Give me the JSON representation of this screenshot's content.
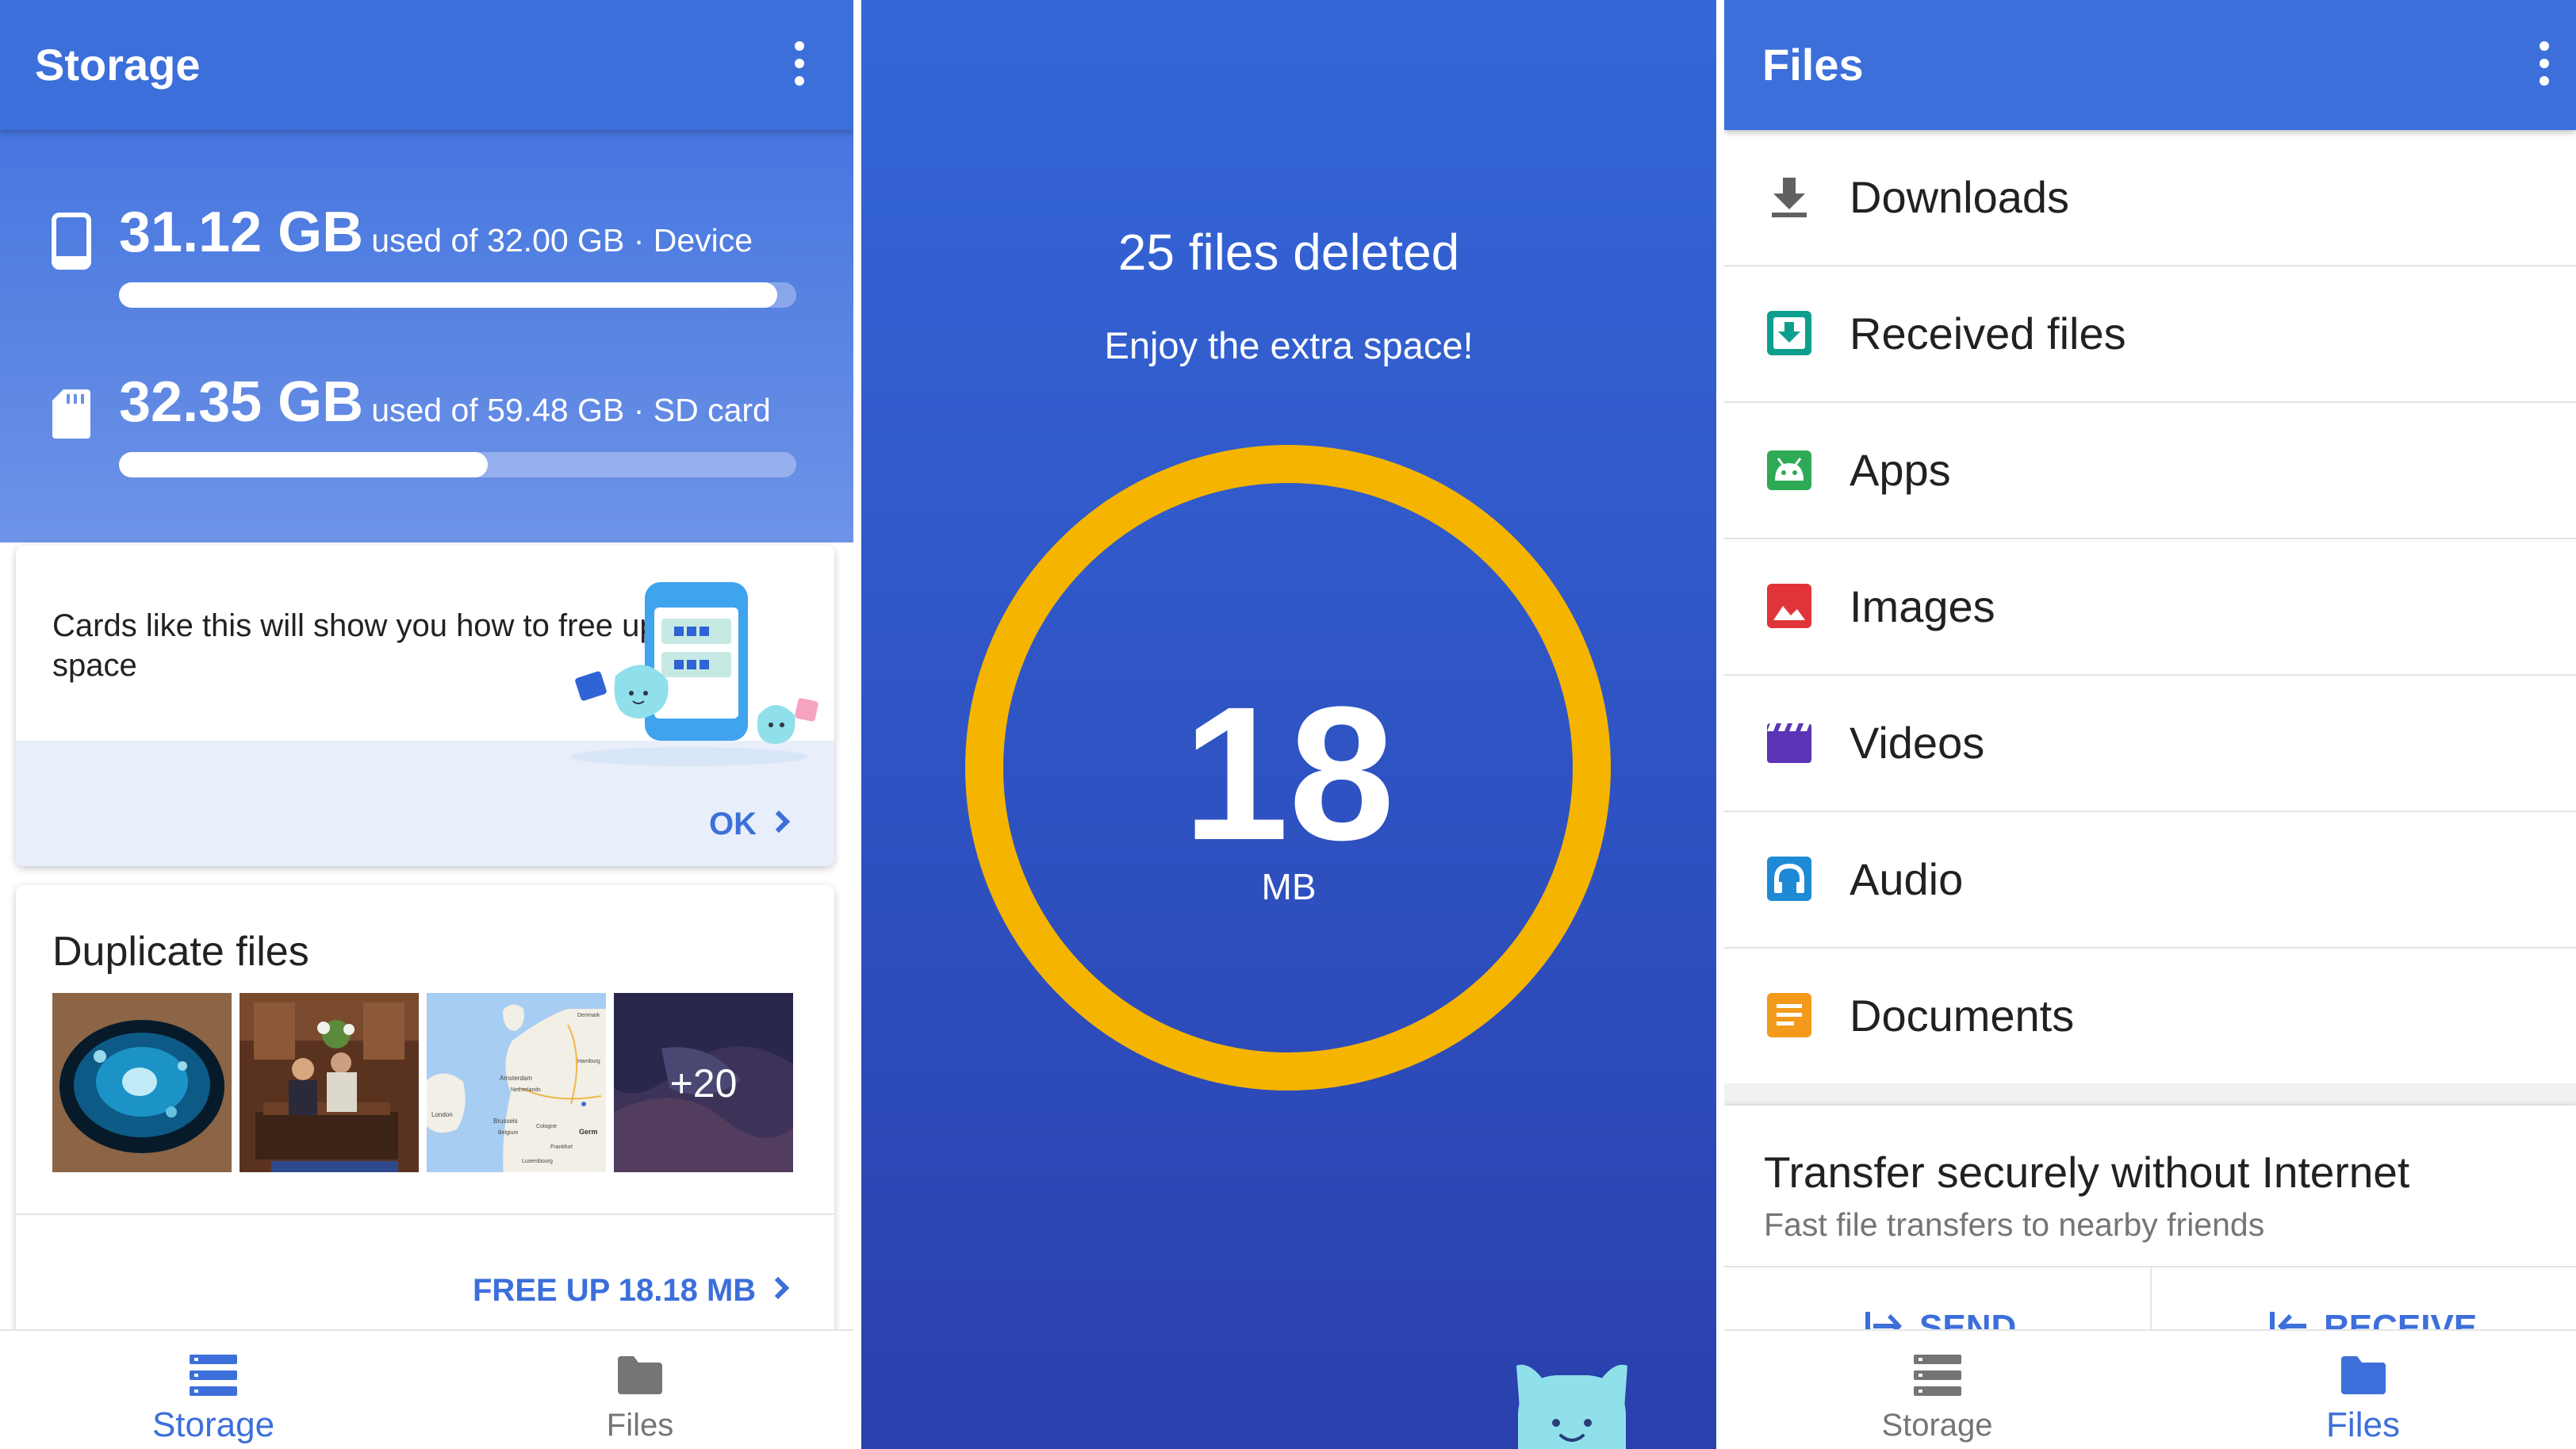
{
  "storage_screen": {
    "title": "Storage",
    "device": {
      "amount": "31.12 GB",
      "detail": "used of 32.00 GB · Device",
      "fraction": 0.972
    },
    "sd_card": {
      "amount": "32.35 GB",
      "detail": "used of 59.48 GB · SD card",
      "fraction": 0.544
    },
    "tip_card": {
      "text": "Cards like this will show you how to free up space",
      "ok_label": "OK"
    },
    "duplicate_card": {
      "title": "Duplicate files",
      "more_count": "+20",
      "action_label": "FREE UP 18.18 MB"
    },
    "map_labels": [
      "London",
      "Amsterdam",
      "Netherlands",
      "Brussels",
      "Belgium",
      "Cologne",
      "Germ",
      "Frankfurt",
      "Luxembourg",
      "Hamburg",
      "Denmark"
    ],
    "nav": {
      "storage_label": "Storage",
      "files_label": "Files",
      "active": "storage"
    }
  },
  "cleanup_screen": {
    "title": "25 files deleted",
    "subtitle": "Enjoy the extra space!",
    "value": "18",
    "unit": "MB"
  },
  "files_screen": {
    "title": "Files",
    "items": [
      {
        "label": "Downloads",
        "icon": "download-icon",
        "color": "#616161"
      },
      {
        "label": "Received files",
        "icon": "received-files-icon",
        "color": "#0e9e8e"
      },
      {
        "label": "Apps",
        "icon": "android-icon",
        "color": "#2eaa56"
      },
      {
        "label": "Images",
        "icon": "image-icon",
        "color": "#e0343a"
      },
      {
        "label": "Videos",
        "icon": "video-clapper-icon",
        "color": "#5b34b8"
      },
      {
        "label": "Audio",
        "icon": "headphones-icon",
        "color": "#1e8ad6"
      },
      {
        "label": "Documents",
        "icon": "document-icon",
        "color": "#f39a1d"
      }
    ],
    "transfer": {
      "title": "Transfer securely without Internet",
      "subtitle": "Fast file transfers to nearby friends",
      "send_label": "SEND",
      "receive_label": "RECEIVE"
    },
    "nav": {
      "storage_label": "Storage",
      "files_label": "Files",
      "active": "files"
    }
  },
  "colors": {
    "accent": "#3c6fda",
    "ring": "#f4b400",
    "background_blue": "#2f54c4"
  }
}
